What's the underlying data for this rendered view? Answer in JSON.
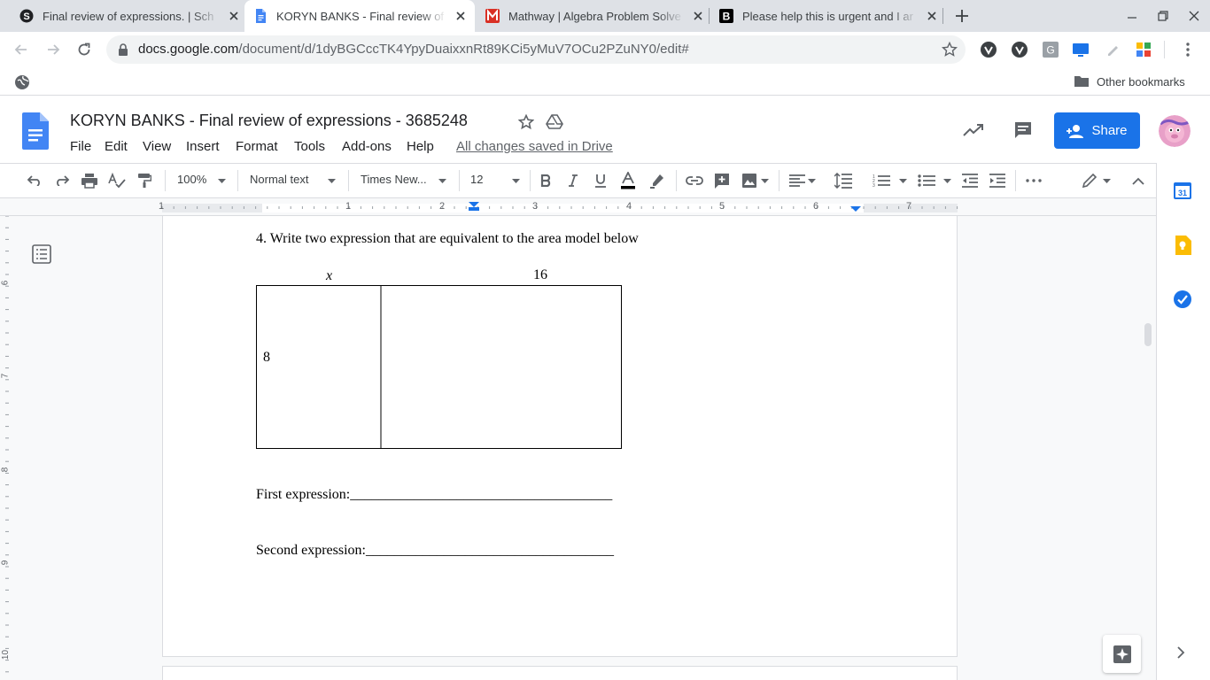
{
  "browser": {
    "tabs": [
      {
        "title": "Final review of expressions. | Sch",
        "active": false
      },
      {
        "title": "KORYN BANKS - Final review of e",
        "active": true
      },
      {
        "title": "Mathway | Algebra Problem Solve",
        "active": false
      },
      {
        "title": "Please help this is urgent and I ar",
        "active": false
      }
    ],
    "url_host": "docs.google.com",
    "url_path": "/document/d/1dyBGCccTK4YpyDuaixxnRt89KCi5yMuV7OCu2PZuNY0/edit#",
    "bookmarks": {
      "other_label": "Other bookmarks"
    }
  },
  "docs": {
    "title": "KORYN BANKS - Final review of expressions - 3685248",
    "menu": [
      "File",
      "Edit",
      "View",
      "Insert",
      "Format",
      "Tools",
      "Add-ons",
      "Help"
    ],
    "saved_status": "All changes saved in Drive",
    "share_label": "Share",
    "toolbar": {
      "zoom": "100%",
      "style": "Normal text",
      "font": "Times New...",
      "font_size": "12"
    },
    "ruler": {
      "h_labels": [
        "1",
        "1",
        "2",
        "3",
        "4",
        "5",
        "6",
        "7"
      ],
      "v_labels": [
        "6",
        "7",
        "8",
        "9",
        "10"
      ]
    }
  },
  "document": {
    "question": "4. Write two expression that are equivalent to the area model below",
    "area_model": {
      "top_left_label": "x",
      "top_right_label": "16",
      "side_label": "8"
    },
    "first_expression": "First expression:",
    "first_blank": "_____________________________________",
    "second_expression": "Second expression:",
    "second_blank": "___________________________________"
  },
  "colors": {
    "accent": "#1a73e8",
    "tab_strip": "#dee1e6",
    "canvas": "#f8f9fa"
  }
}
